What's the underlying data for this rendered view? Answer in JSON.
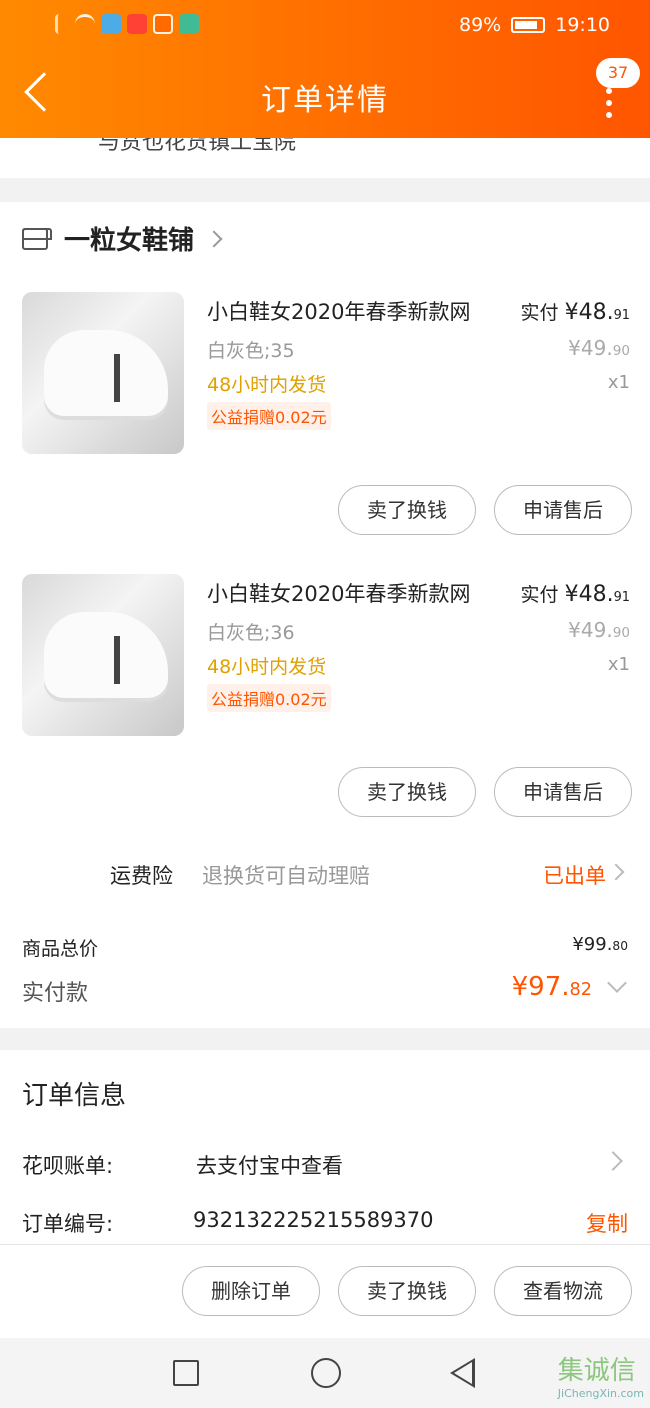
{
  "status_bar": {
    "battery": "89%",
    "time": "19:10"
  },
  "header": {
    "title": "订单详情",
    "badge": "37"
  },
  "prev_strip": {
    "text": "与贲也花货镇工宝院"
  },
  "shop": {
    "name": "一粒女鞋铺"
  },
  "items": [
    {
      "name": "小白鞋女2020年春季新款网",
      "variant": "白灰色;35",
      "shipping": "48小时内发货",
      "donation": "公益捐赠0.02元",
      "paid_label": "实付",
      "paid_int": "¥48.",
      "paid_dec": "91",
      "orig_int": "¥49.",
      "orig_dec": "90",
      "qty": "x1",
      "btn1": "卖了换钱",
      "btn2": "申请售后"
    },
    {
      "name": "小白鞋女2020年春季新款网",
      "variant": "白灰色;36",
      "shipping": "48小时内发货",
      "donation": "公益捐赠0.02元",
      "paid_label": "实付",
      "paid_int": "¥48.",
      "paid_dec": "91",
      "orig_int": "¥49.",
      "orig_dec": "90",
      "qty": "x1",
      "btn1": "卖了换钱",
      "btn2": "申请售后"
    }
  ],
  "insurance": {
    "label": "运费险",
    "desc": "退换货可自动理赔",
    "status": "已出单"
  },
  "totals": {
    "total_label": "商品总价",
    "total_int": "¥99.",
    "total_dec": "80",
    "paid_label": "实付款",
    "paid_int": "¥97.",
    "paid_dec": "82"
  },
  "order_info": {
    "title": "订单信息",
    "huabei_label": "花呗账单:",
    "huabei_value": "去支付宝中查看",
    "order_no_label": "订单编号:",
    "order_no_value": "932132225215589370",
    "copy": "复制"
  },
  "actions": {
    "delete": "删除订单",
    "sell": "卖了换钱",
    "logistics": "查看物流"
  },
  "watermark": {
    "text": "集诚信",
    "sub": "JiChengXin.com"
  }
}
